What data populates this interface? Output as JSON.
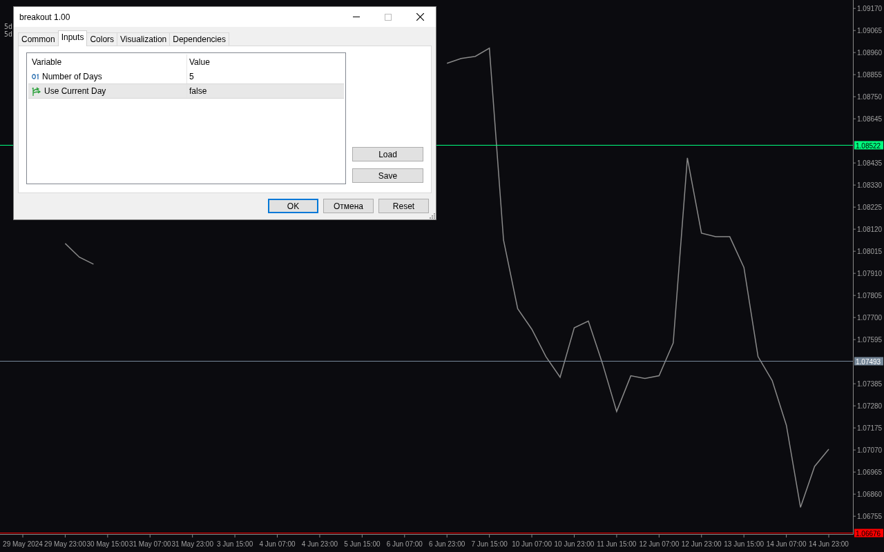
{
  "chart": {
    "legend": [
      "5d",
      "5d"
    ],
    "chart_data": {
      "type": "line",
      "ylim": [
        1.0668,
        1.0921
      ],
      "yticks": [
        {
          "value": 1.0917,
          "label": "1.09170"
        },
        {
          "value": 1.09065,
          "label": "1.09065"
        },
        {
          "value": 1.0896,
          "label": "1.08960"
        },
        {
          "value": 1.08855,
          "label": "1.08855"
        },
        {
          "value": 1.0875,
          "label": "1.08750"
        },
        {
          "value": 1.08645,
          "label": "1.08645"
        },
        {
          "value": 1.08435,
          "label": "1.08435"
        },
        {
          "value": 1.0833,
          "label": "1.08330"
        },
        {
          "value": 1.08225,
          "label": "1.08225"
        },
        {
          "value": 1.0812,
          "label": "1.08120"
        },
        {
          "value": 1.08015,
          "label": "1.08015"
        },
        {
          "value": 1.0791,
          "label": "1.07910"
        },
        {
          "value": 1.07805,
          "label": "1.07805"
        },
        {
          "value": 1.077,
          "label": "1.07700"
        },
        {
          "value": 1.07595,
          "label": "1.07595"
        },
        {
          "value": 1.07385,
          "label": "1.07385"
        },
        {
          "value": 1.0728,
          "label": "1.07280"
        },
        {
          "value": 1.07175,
          "label": "1.07175"
        },
        {
          "value": 1.0707,
          "label": "1.07070"
        },
        {
          "value": 1.06965,
          "label": "1.06965"
        },
        {
          "value": 1.0686,
          "label": "1.06860"
        },
        {
          "value": 1.06755,
          "label": "1.06755"
        }
      ],
      "categories": [
        "29 May 2024",
        null,
        null,
        "29 May 23:00",
        null,
        null,
        "30 May 15:00",
        null,
        null,
        "31 May 07:00",
        null,
        null,
        "31 May 23:00",
        null,
        null,
        "3 Jun 15:00",
        null,
        null,
        "4 Jun 07:00",
        null,
        null,
        "4 Jun 23:00",
        null,
        null,
        "5 Jun 15:00",
        null,
        null,
        "6 Jun 07:00",
        null,
        null,
        "6 Jun 23:00",
        null,
        null,
        "7 Jun 15:00",
        null,
        null,
        "10 Jun 07:00",
        null,
        null,
        "10 Jun 23:00",
        null,
        null,
        "11 Jun 15:00",
        null,
        null,
        "12 Jun 07:00",
        null,
        null,
        "12 Jun 23:00",
        null,
        null,
        "13 Jun 15:00",
        null,
        null,
        "14 Jun 07:00",
        null,
        null,
        "14 Jun 23:00"
      ],
      "values": [
        null,
        null,
        null,
        1.08052,
        1.07987,
        1.07954,
        null,
        null,
        null,
        null,
        null,
        null,
        null,
        null,
        null,
        null,
        null,
        null,
        null,
        null,
        null,
        null,
        null,
        null,
        null,
        null,
        null,
        null,
        null,
        null,
        1.08909,
        1.08932,
        1.08942,
        1.08981,
        1.08068,
        1.07742,
        1.07644,
        1.07514,
        1.07416,
        1.07651,
        1.07683,
        1.07481,
        1.07253,
        1.07423,
        1.0741,
        1.07423,
        1.07579,
        1.08459,
        1.08101,
        1.08084,
        1.08084,
        1.07938,
        1.07514,
        1.074,
        1.07188,
        1.06797,
        1.06992,
        1.07074
      ],
      "ref_lines": [
        {
          "axis": "y",
          "value": 1.08522,
          "label": "1.08522",
          "color": "#00ff7f"
        },
        {
          "axis": "y",
          "value": 1.07493,
          "label": "1.07493",
          "color": "#778899"
        },
        {
          "axis": "y",
          "value": 1.06676,
          "label": "1.06676",
          "color": "#ff0000"
        }
      ]
    }
  },
  "dialog": {
    "title": "breakout 1.00",
    "tabs": [
      {
        "label": "Common",
        "selected": false
      },
      {
        "label": "Inputs",
        "selected": true
      },
      {
        "label": "Colors",
        "selected": false
      },
      {
        "label": "Visualization",
        "selected": false
      },
      {
        "label": "Dependencies",
        "selected": false
      }
    ],
    "table": {
      "columns": [
        "Variable",
        "Value"
      ],
      "rows": [
        {
          "kind": "integer",
          "variable": "Number of Days",
          "value": "5",
          "selected": false
        },
        {
          "kind": "boolean",
          "variable": "Use Current Day",
          "value": "false",
          "selected": true
        }
      ]
    },
    "side_buttons": [
      "Load",
      "Save"
    ],
    "buttons": [
      {
        "label": "OK",
        "default": true
      },
      {
        "label": "Отмена",
        "default": false
      },
      {
        "label": "Reset",
        "default": false
      }
    ]
  }
}
